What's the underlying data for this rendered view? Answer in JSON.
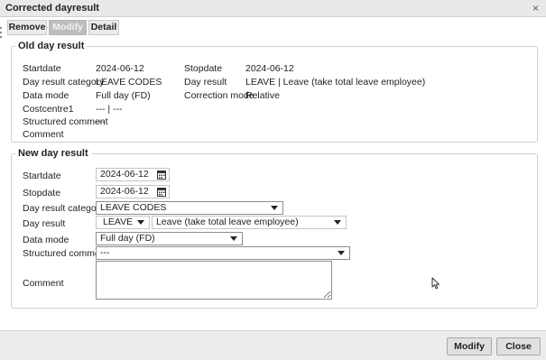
{
  "window": {
    "title": "Corrected dayresult",
    "close_glyph": "×"
  },
  "tabs": [
    {
      "label": "Remove",
      "active": false
    },
    {
      "label": "Modify",
      "active": true
    },
    {
      "label": "Detail",
      "active": false
    }
  ],
  "old": {
    "legend": "Old day result",
    "startdate_label": "Startdate",
    "startdate_value": "2024-06-12",
    "stopdate_label": "Stopdate",
    "stopdate_value": "2024-06-12",
    "category_label": "Day result category",
    "category_value": "LEAVE CODES",
    "dayresult_label": "Day result",
    "dayresult_value": "LEAVE | Leave (take total leave employee)",
    "datamode_label": "Data mode",
    "datamode_value": "Full day (FD)",
    "correction_label": "Correction mode",
    "correction_value": "Relative",
    "costcentre_label": "Costcentre1",
    "costcentre_value": "--- | ---",
    "structured_label": "Structured comment",
    "structured_value": "---",
    "comment_label": "Comment"
  },
  "new": {
    "legend": "New day result",
    "startdate_label": "Startdate",
    "startdate_value": "2024-06-12",
    "stopdate_label": "Stopdate",
    "stopdate_value": "2024-06-12",
    "category_label": "Day result category",
    "category_value": "LEAVE CODES",
    "dayresult_label": "Day result",
    "dayresult_code_value": "LEAVE",
    "dayresult_desc_value": "Leave (take total leave employee)",
    "datamode_label": "Data mode",
    "datamode_value": "Full day (FD)",
    "structured_label": "Structured comment",
    "structured_value": "---",
    "comment_label": "Comment",
    "comment_value": ""
  },
  "buttons": {
    "modify": "Modify",
    "close": "Close"
  },
  "icons": {
    "calendar": "calendar-icon",
    "dropdown": "chevron-down-icon",
    "close": "close-icon"
  }
}
